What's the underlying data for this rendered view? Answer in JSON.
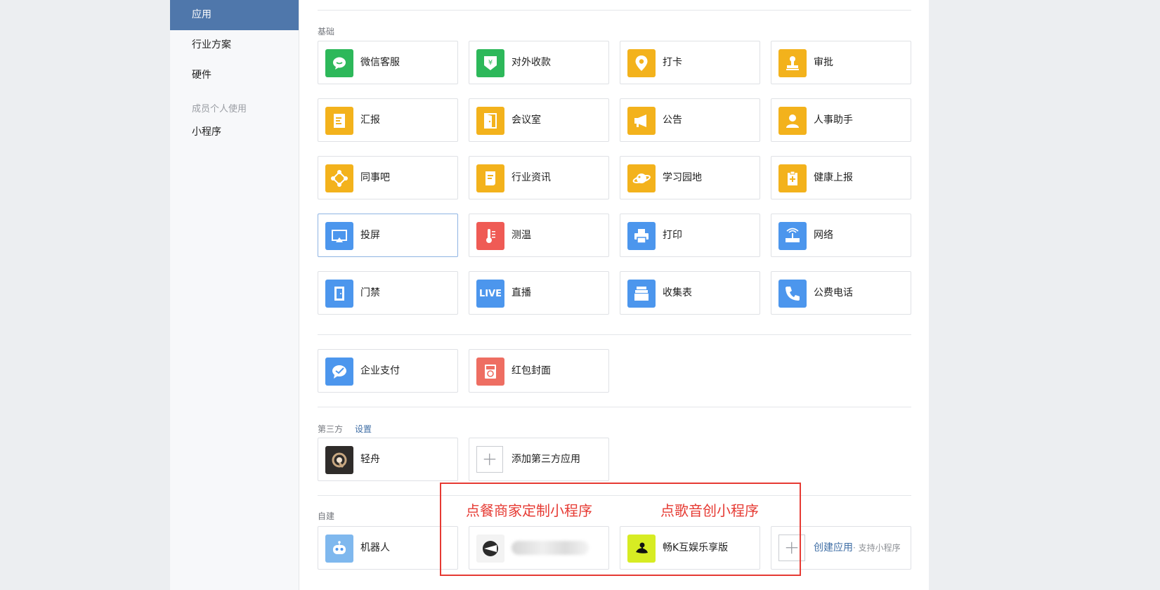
{
  "sidebar": {
    "items": [
      {
        "label": "应用",
        "active": true
      },
      {
        "label": "行业方案"
      },
      {
        "label": "硬件"
      }
    ],
    "group_title": "成员个人使用",
    "sub_items": [
      {
        "label": "小程序"
      }
    ]
  },
  "sections": {
    "basic": {
      "title": "基础",
      "apps": [
        {
          "label": "微信客服",
          "icon": "wechat-chat-icon",
          "color": "#2db85a"
        },
        {
          "label": "对外收款",
          "icon": "yuan-shield-icon",
          "color": "#2db85a"
        },
        {
          "label": "打卡",
          "icon": "location-pin-icon",
          "color": "#f3b21c"
        },
        {
          "label": "审批",
          "icon": "stamp-icon",
          "color": "#f3b21c"
        },
        {
          "label": "汇报",
          "icon": "report-document-icon",
          "color": "#f3b21c"
        },
        {
          "label": "会议室",
          "icon": "door-icon",
          "color": "#f3b21c"
        },
        {
          "label": "公告",
          "icon": "megaphone-icon",
          "color": "#f3b21c"
        },
        {
          "label": "人事助手",
          "icon": "person-icon",
          "color": "#f3b21c"
        },
        {
          "label": "同事吧",
          "icon": "network-nodes-icon",
          "color": "#f3b21c"
        },
        {
          "label": "行业资讯",
          "icon": "news-scroll-icon",
          "color": "#f3b21c"
        },
        {
          "label": "学习园地",
          "icon": "planet-icon",
          "color": "#f3b21c"
        },
        {
          "label": "健康上报",
          "icon": "clipboard-plus-icon",
          "color": "#f3b21c"
        },
        {
          "label": "投屏",
          "icon": "screen-cast-icon",
          "color": "#4c96ed"
        },
        {
          "label": "测温",
          "icon": "thermometer-icon",
          "color": "#ef5b55"
        },
        {
          "label": "打印",
          "icon": "printer-icon",
          "color": "#4c96ed"
        },
        {
          "label": "网络",
          "icon": "router-icon",
          "color": "#4c96ed"
        },
        {
          "label": "门禁",
          "icon": "access-door-icon",
          "color": "#4c96ed"
        },
        {
          "label": "直播",
          "icon": "live-icon",
          "color": "#4c96ed",
          "glyph": "LIVE"
        },
        {
          "label": "收集表",
          "icon": "form-tray-icon",
          "color": "#4c96ed"
        },
        {
          "label": "公费电话",
          "icon": "phone-icon",
          "color": "#4c96ed"
        }
      ]
    },
    "payment": {
      "apps": [
        {
          "label": "企业支付",
          "icon": "pay-chat-icon",
          "color": "#4c96ed"
        },
        {
          "label": "红包封面",
          "icon": "red-envelope-icon",
          "color": "#ee6e62"
        }
      ]
    },
    "third_party": {
      "title": "第三方",
      "settings_link": "设置",
      "apps": [
        {
          "label": "轻舟",
          "icon": "qingzhou-logo-icon",
          "color": "#2f2c2a"
        }
      ],
      "add_label": "添加第三方应用"
    },
    "custom": {
      "title": "自建",
      "apps": [
        {
          "label": "机器人",
          "icon": "robot-icon"
        },
        {
          "label": "",
          "icon": "blurred-app-icon"
        },
        {
          "label": "畅K互娱乐享版",
          "icon": "music-bird-icon",
          "color": "#d7ec23"
        }
      ],
      "create_label": "创建应用",
      "create_hint": "· 支持小程序"
    }
  },
  "annotations": {
    "left": "点餐商家定制小程序",
    "right": "点歌音创小程序",
    "color": "#e63a33"
  }
}
